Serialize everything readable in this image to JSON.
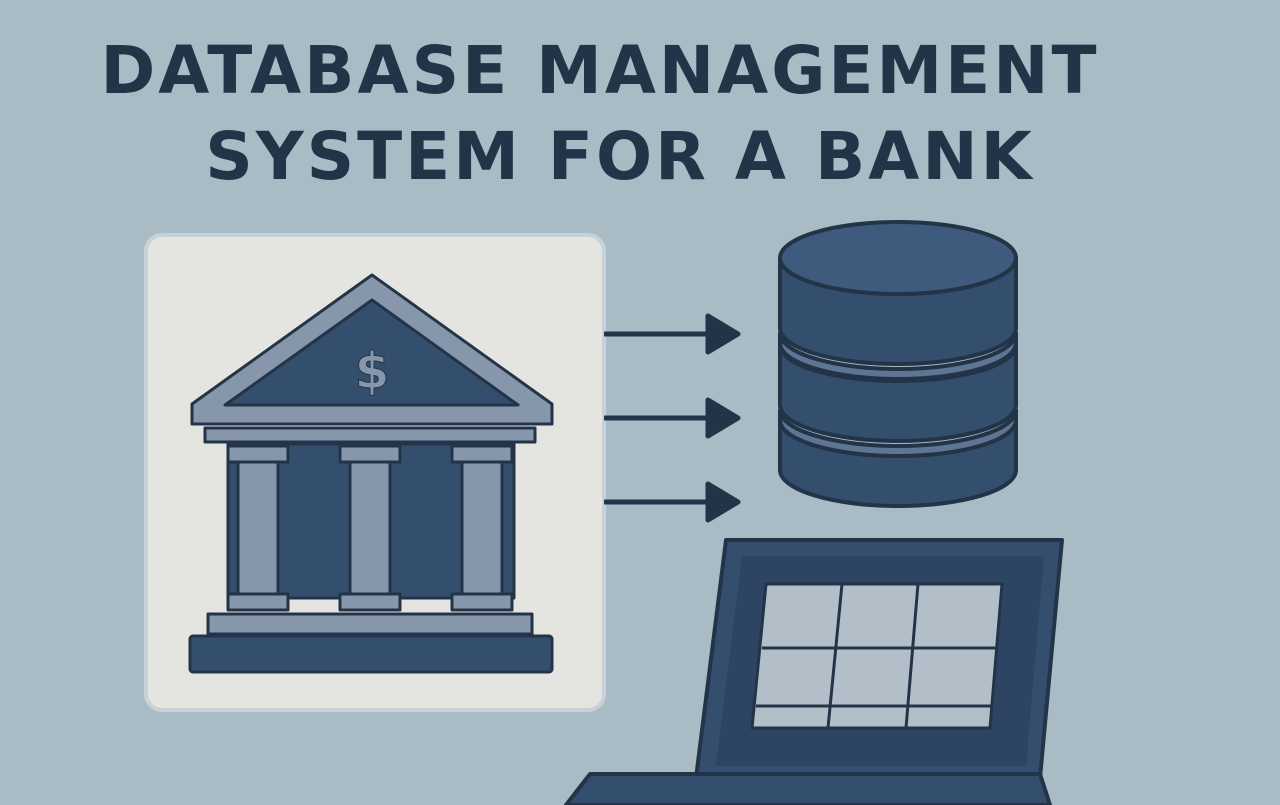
{
  "title": {
    "line1": "DATABASE MANAGEMENT",
    "line2": "SYSTEM FOR A BANK"
  },
  "bank": {
    "symbol": "$",
    "icon": "bank-building-icon"
  },
  "database": {
    "icon": "database-cylinder-icon"
  },
  "laptop": {
    "icon": "laptop-icon"
  },
  "connectors": {
    "icon": "arrow-right-icon",
    "count": 3
  },
  "colors": {
    "background": "#a9bcc6",
    "dark_navy": "#243448",
    "navy": "#344e6e",
    "steel": "#8797ab",
    "panel": "#e4e4e1",
    "screen_grid": "#b2bfc8"
  }
}
